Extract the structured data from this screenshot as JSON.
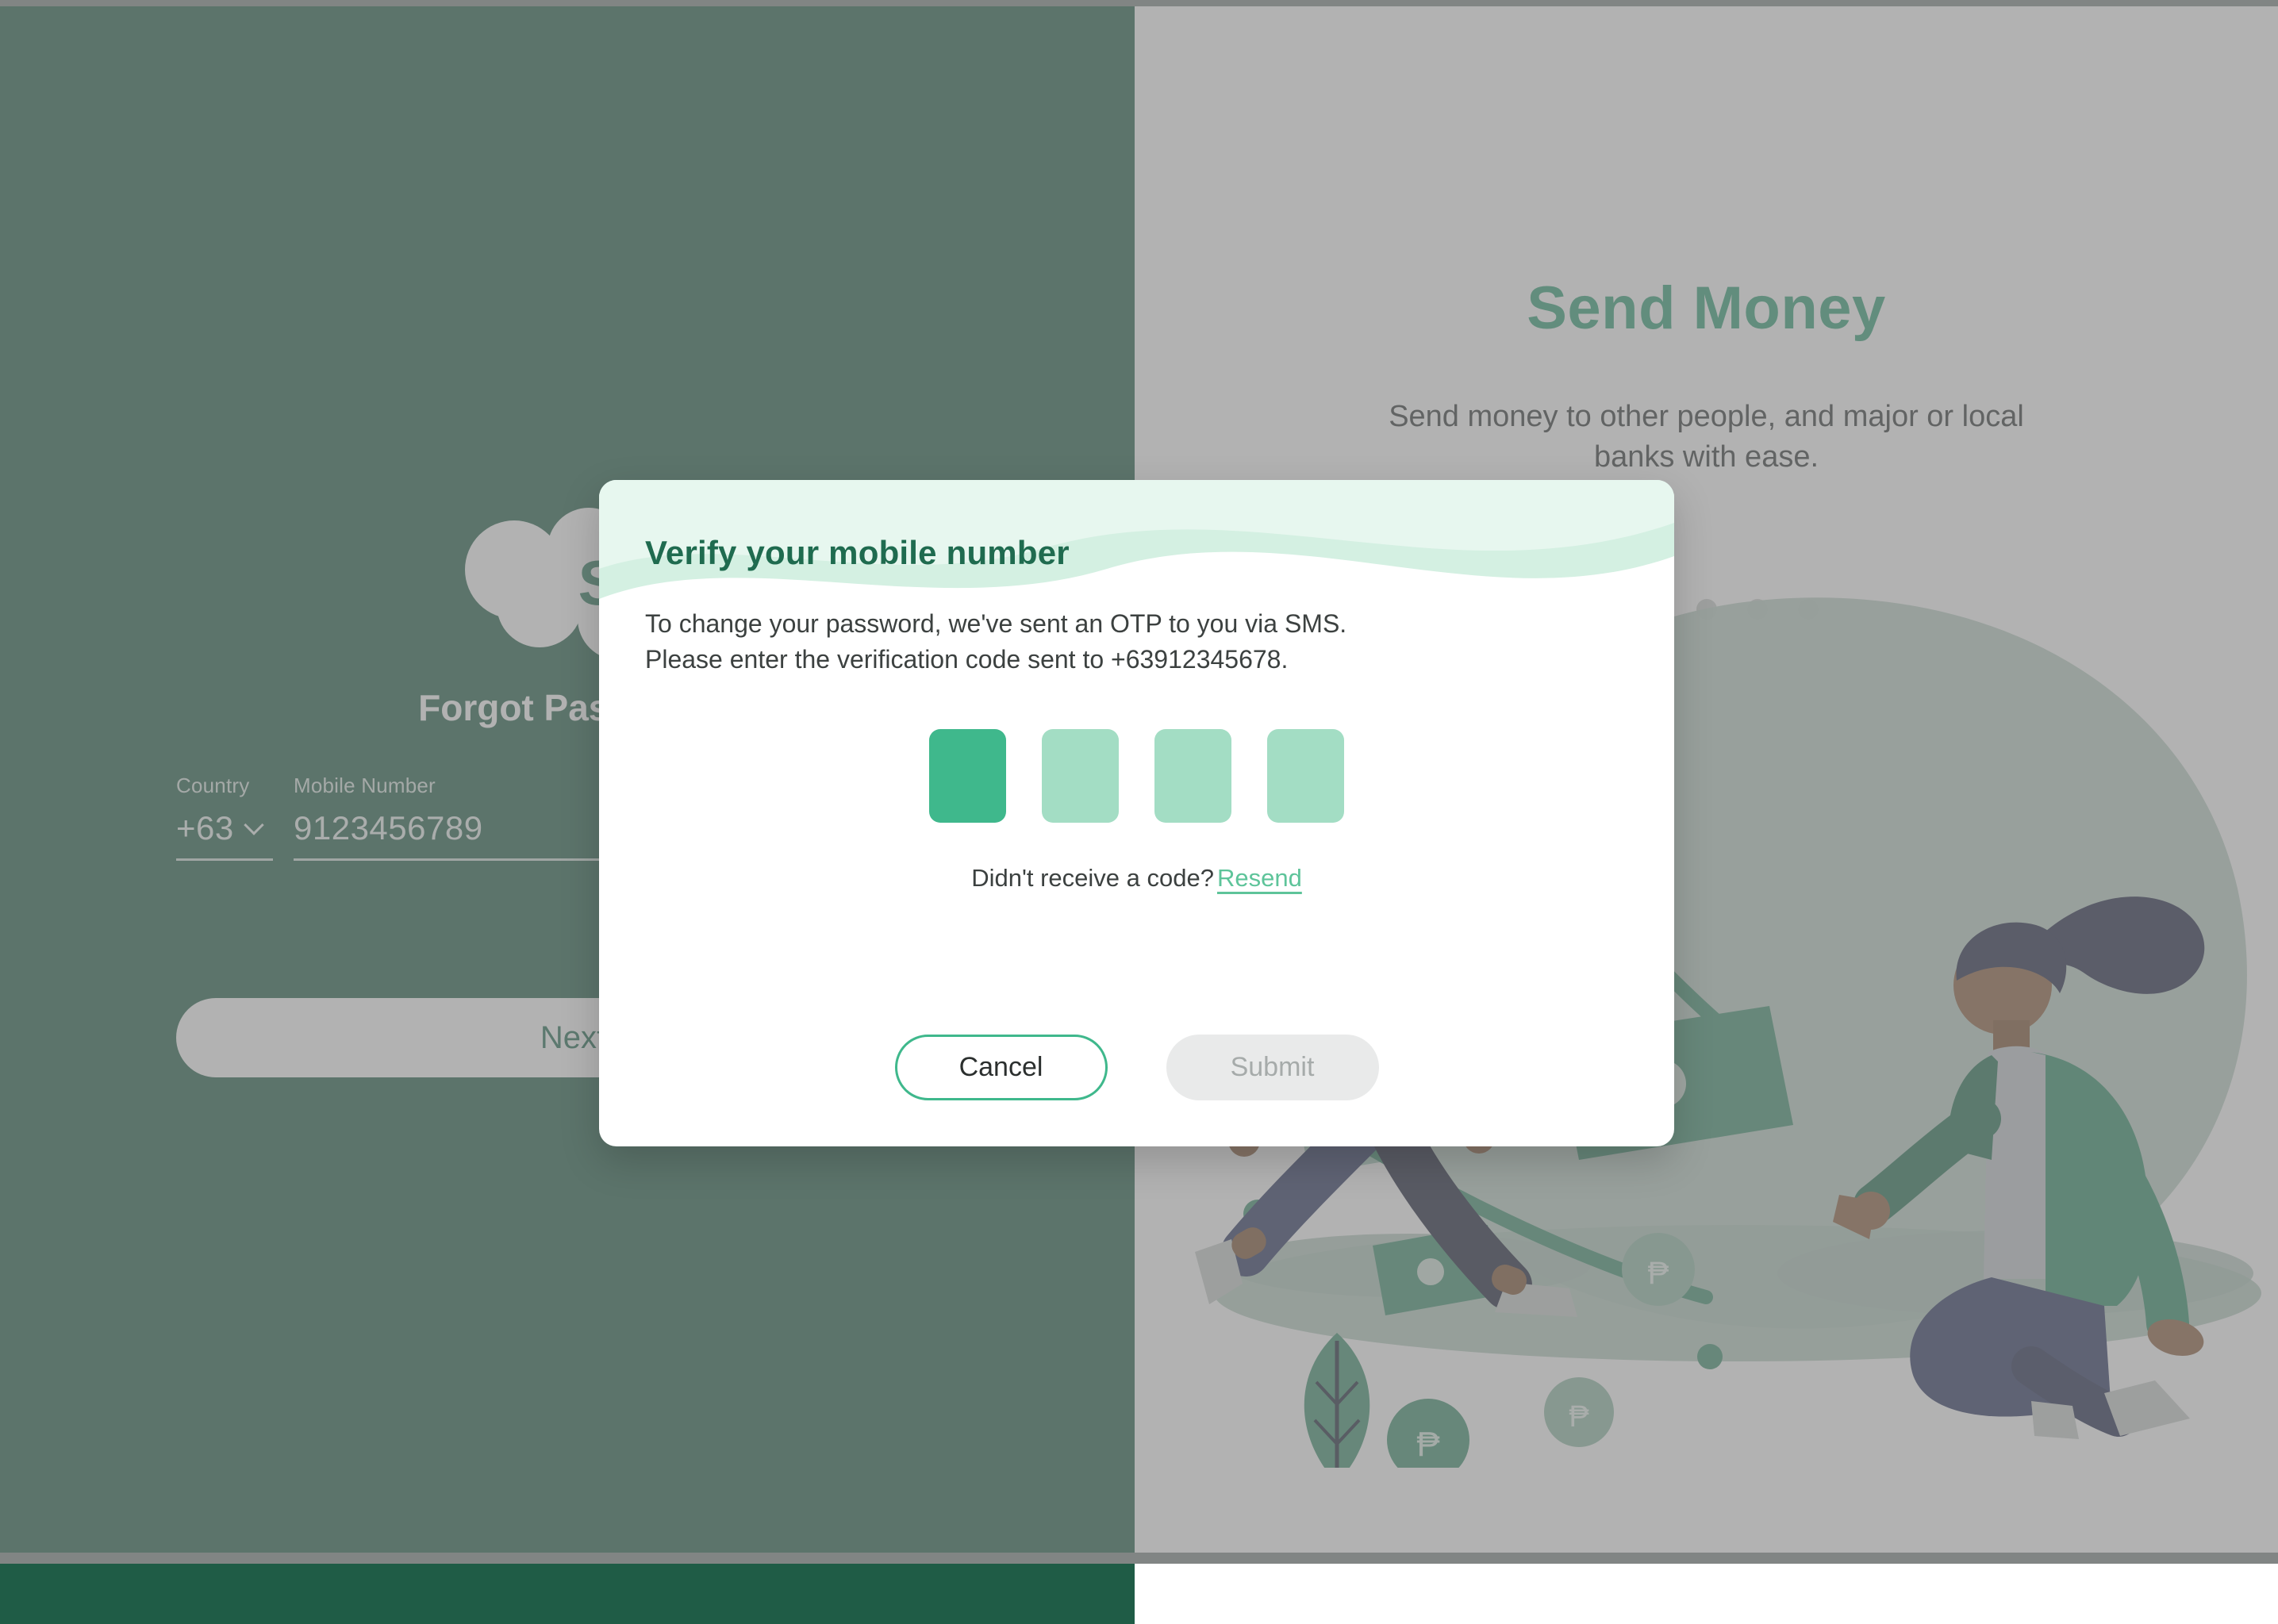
{
  "brand": {
    "logo_text": "SAL",
    "accent_dark": "#1f6b4f",
    "accent": "#3fb88c",
    "accent_light": "#a3ddc4",
    "panel_green": "#1f5c46"
  },
  "left_panel": {
    "heading": "Forgot Password",
    "country": {
      "label": "Country",
      "value": "+63",
      "chevron_icon": "chevron-down-icon"
    },
    "mobile": {
      "label": "Mobile Number",
      "value": "9123456789",
      "placeholder": "Mobile Number"
    },
    "next_button": "Next"
  },
  "right_panel": {
    "slide_title": "Send Money",
    "slide_subtitle": "Send money to other people, and major or local banks with ease.",
    "dots": [
      {
        "active": false
      },
      {
        "active": false
      },
      {
        "active": false
      },
      {
        "active": false
      },
      {
        "active": false
      }
    ],
    "illustration_alt": "send-money-illustration"
  },
  "modal": {
    "title": "Verify your mobile number",
    "body_line1": "To change your password, we've sent an OTP to you via SMS.",
    "body_line2": "Please enter the verification code sent to +63912345678.",
    "otp": {
      "length": 4,
      "boxes": [
        {
          "value": "",
          "filled": true
        },
        {
          "value": "",
          "filled": false
        },
        {
          "value": "",
          "filled": false
        },
        {
          "value": "",
          "filled": false
        }
      ]
    },
    "resend_prompt": "Didn't receive a code?",
    "resend_link": "Resend",
    "cancel_button": "Cancel",
    "submit_button": "Submit",
    "submit_disabled": true
  }
}
